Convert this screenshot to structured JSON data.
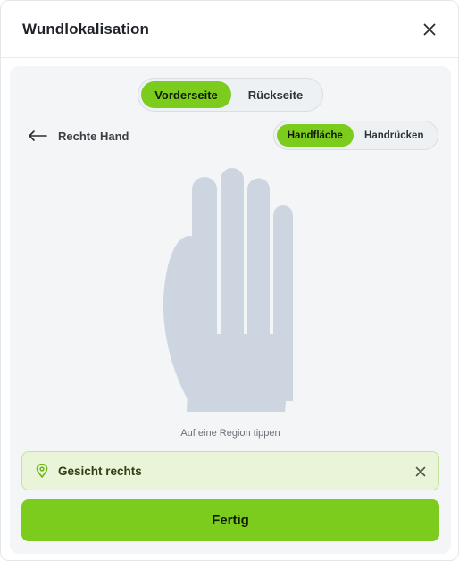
{
  "dialog": {
    "title": "Wundlokalisation",
    "close_icon": "close-icon"
  },
  "side_toggle": {
    "options": [
      "Vorderseite",
      "Rückseite"
    ],
    "selected": "Vorderseite"
  },
  "body_part": {
    "back_icon": "arrow-left-icon",
    "label": "Rechte Hand"
  },
  "view_toggle": {
    "options": [
      "Handfläche",
      "Handrücken"
    ],
    "selected": "Handfläche"
  },
  "hint": "Auf eine Region tippen",
  "selection": {
    "icon": "map-pin-icon",
    "label": "Gesicht rechts",
    "clear_icon": "close-icon"
  },
  "done_button": "Fertig",
  "colors": {
    "accent": "#7ccc1e",
    "selection_bg": "#e9f4d8",
    "selection_border": "#c4e29c",
    "region_fill": "#cdd6e0",
    "panel_bg": "#f3f5f7"
  }
}
